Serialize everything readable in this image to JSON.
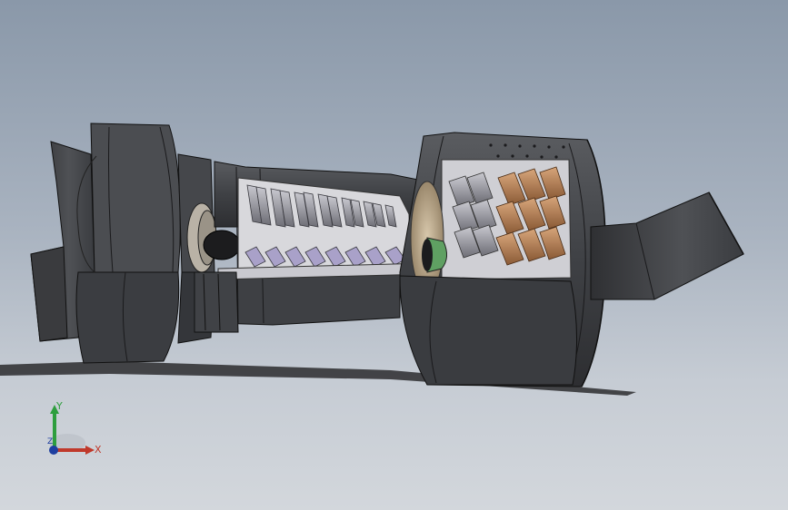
{
  "viewport": {
    "background_top": "#8a98a9",
    "background_bottom": "#d3d7dc",
    "model_description_icon": "turbojet-engine-section-model"
  },
  "triad": {
    "x_label": "X",
    "y_label": "Y",
    "z_label": "Z",
    "x_color": "#c0392b",
    "y_color": "#2e9e3e",
    "z_color": "#1f3fa0"
  },
  "colors": {
    "casing": "#4a4c50",
    "casing_dark": "#2f3033",
    "casing_light": "#6a6c70",
    "compressor_blades": "#8f8f95",
    "turbine_blades": "#b07a4e",
    "nose_cone": "#5fa062",
    "bearing": "#b9b2a6"
  }
}
